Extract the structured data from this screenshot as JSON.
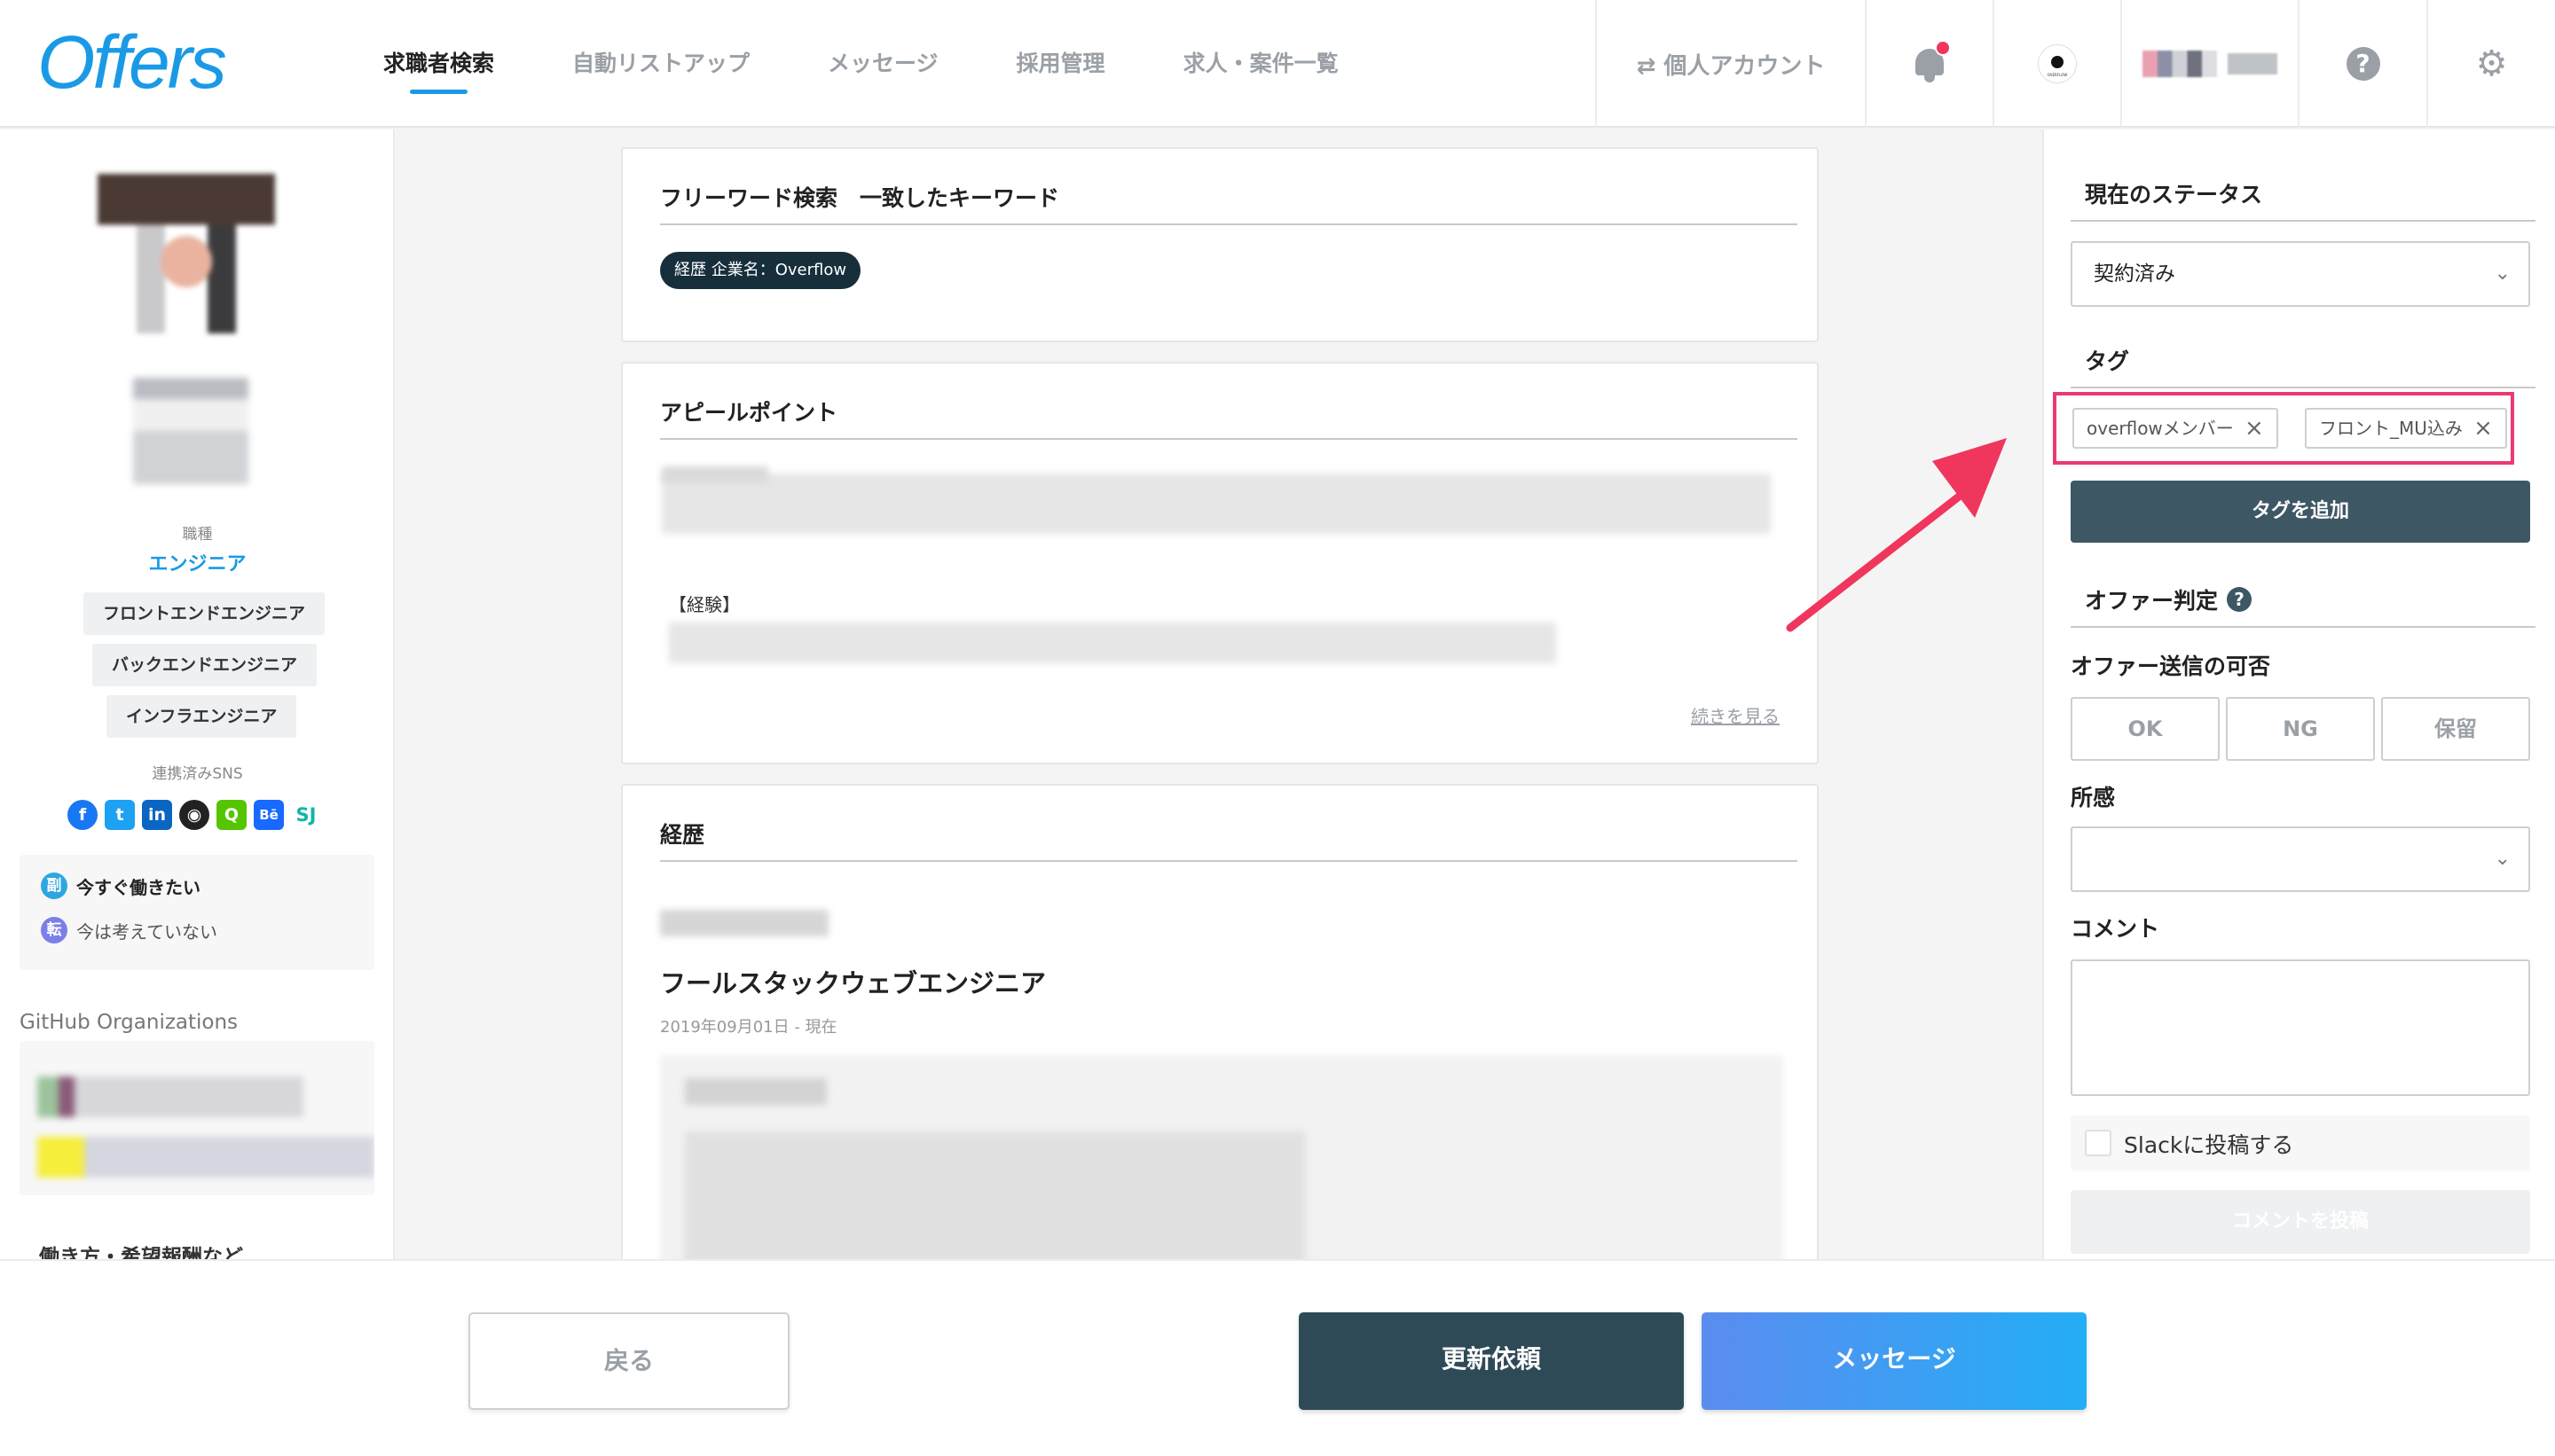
{
  "header": {
    "logo": "Offers",
    "nav": [
      {
        "label": "求職者検索",
        "active": true
      },
      {
        "label": "自動リストアップ",
        "active": false
      },
      {
        "label": "メッセージ",
        "active": false
      },
      {
        "label": "採用管理",
        "active": false
      },
      {
        "label": "求人・案件一覧",
        "active": false
      }
    ],
    "account_switch": "⇄ 個人アカウント",
    "help": "?",
    "settings_icon": "gear-icon"
  },
  "profile": {
    "job_type_label": "職種",
    "role": "エンジニア",
    "skills": [
      "フロントエンドエンジニア",
      "バックエンドエンジニア",
      "インフラエンジニア"
    ],
    "sns_label": "連携済みSNS",
    "sns": [
      {
        "name": "facebook",
        "glyph": "f",
        "color": "#1877f2"
      },
      {
        "name": "twitter",
        "glyph": "t",
        "color": "#1da1f2"
      },
      {
        "name": "linkedin",
        "glyph": "in",
        "color": "#0a66c2"
      },
      {
        "name": "github",
        "glyph": "◉",
        "color": "#222222"
      },
      {
        "name": "qiita",
        "glyph": "Q",
        "color": "#55c500"
      },
      {
        "name": "behance",
        "glyph": "Bē",
        "color": "#1769ff"
      },
      {
        "name": "sj",
        "glyph": "SJ",
        "color": "#0fb5a8"
      }
    ],
    "work_status": [
      {
        "badge": "副",
        "text": "今すぐ働きたい",
        "color": "#2ea7e0"
      },
      {
        "badge": "転",
        "text": "今は考えていない",
        "color": "#7b7fe8"
      }
    ],
    "github_orgs_title": "GitHub Organizations",
    "work_style_title": "働き方・希望報酬など"
  },
  "main": {
    "keyword_card": {
      "title": "フリーワード検索　一致したキーワード",
      "chip": "経歴 企業名：Overflow"
    },
    "appeal_card": {
      "title": "アピールポイント",
      "experience_label": "【経験】",
      "more_link": "続きを見る"
    },
    "career_card": {
      "title": "経歴",
      "job_title": "フールスタックウェブエンジニア",
      "period": "2019年09月01日 - 現在"
    }
  },
  "right_panel": {
    "status_title": "現在のステータス",
    "status_value": "契約済み",
    "tags_title": "タグ",
    "tags": [
      "overflowメンバー",
      "フロント_MU込み"
    ],
    "add_tag_button": "タグを追加",
    "offer_judgement_title": "オファー判定",
    "offer_send_label": "オファー送信の可否",
    "offer_options": [
      "OK",
      "NG",
      "保留"
    ],
    "impression_label": "所感",
    "comment_label": "コメント",
    "slack_label": "Slackに投稿する",
    "post_comment_button": "コメントを投稿"
  },
  "footer": {
    "back": "戻る",
    "update_request": "更新依頼",
    "message": "メッセージ"
  },
  "colors": {
    "brand": "#1a9ae6",
    "dark_button": "#2f4a57",
    "highlight": "#ea3a70"
  }
}
